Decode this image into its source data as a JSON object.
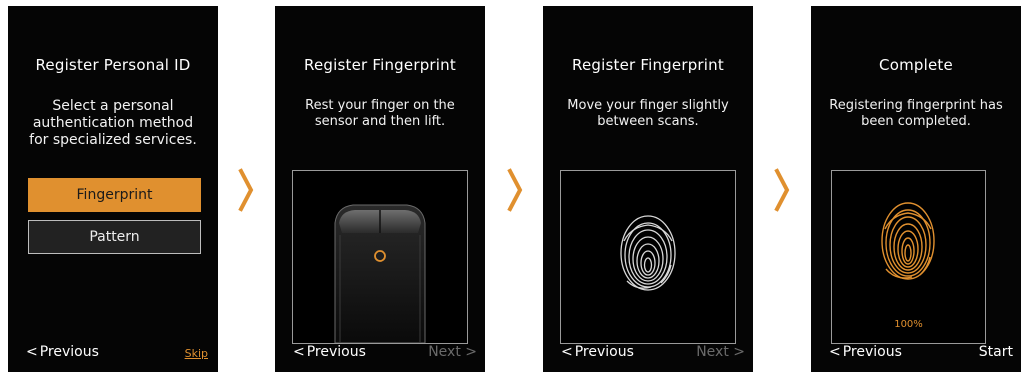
{
  "colors": {
    "accent": "#e0902f",
    "screen_bg": "#050505",
    "disabled_text": "#6a6a6a"
  },
  "screens": [
    {
      "title": "Register Personal ID",
      "message_lines": [
        "Select a personal",
        "authentication method",
        "for specialized services."
      ],
      "primary_button": "Fingerprint",
      "secondary_button": "Pattern",
      "footer_left": "Previous",
      "footer_right": "Skip"
    },
    {
      "title": "Register Fingerprint",
      "message_lines": [
        "Rest your finger on the",
        "sensor and then lift."
      ],
      "illustration": "phone-sensor",
      "footer_left": "Previous",
      "footer_right": "Next"
    },
    {
      "title": "Register Fingerprint",
      "message_lines": [
        "Move your finger slightly",
        "between scans."
      ],
      "illustration": "fingerprint-outline",
      "footer_left": "Previous",
      "footer_right": "Next"
    },
    {
      "title": "Complete",
      "message_lines": [
        "Registering fingerprint has",
        "been completed."
      ],
      "illustration": "fingerprint-filled",
      "progress_label": "100%",
      "progress": 1.0,
      "footer_left": "Previous",
      "footer_right": "Start"
    }
  ],
  "icons": {
    "step_arrow": "chevron-right-icon",
    "back": "chevron-left-icon",
    "forward": "chevron-right-icon"
  }
}
